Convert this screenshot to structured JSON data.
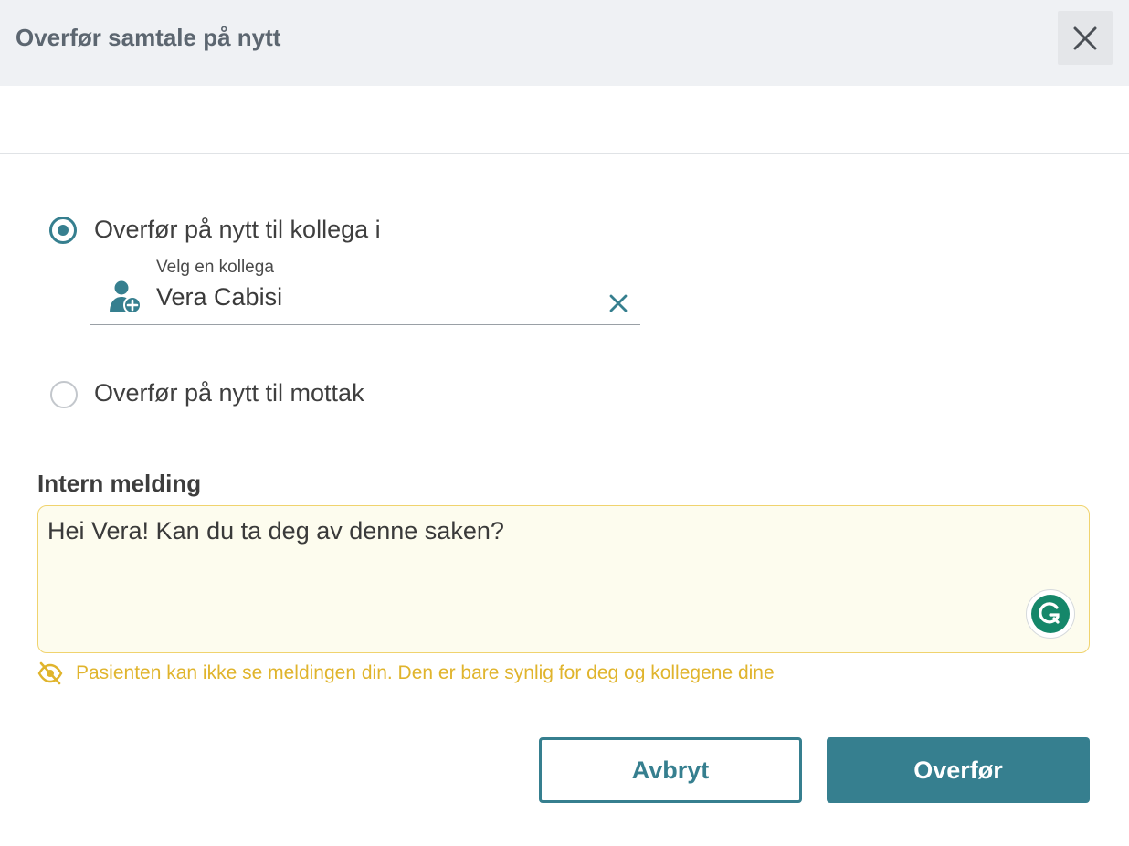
{
  "dialog": {
    "title": "Overfør samtale på nytt",
    "close_icon": "close-icon"
  },
  "options": [
    {
      "label": "Overfør på nytt til kollega i",
      "selected": true
    },
    {
      "label": "Overfør på nytt til mottak",
      "selected": false
    }
  ],
  "colleague_field": {
    "label": "Velg en kollega",
    "value": "Vera Cabisi",
    "icon": "person-add-icon",
    "clear_icon": "clear-icon"
  },
  "message": {
    "label": "Intern melding",
    "value": "Hei Vera! Kan du ta deg av denne saken?",
    "notice": "Pasienten kan ikke se meldingen din. Den er bare synlig for deg og kollegene dine",
    "notice_icon": "eye-off-icon"
  },
  "buttons": {
    "cancel": "Avbryt",
    "submit": "Overfør"
  },
  "colors": {
    "accent": "#367f8f",
    "warning": "#e0b42c",
    "textarea_bg": "#fdfcee",
    "header_bg": "#eff1f4"
  }
}
